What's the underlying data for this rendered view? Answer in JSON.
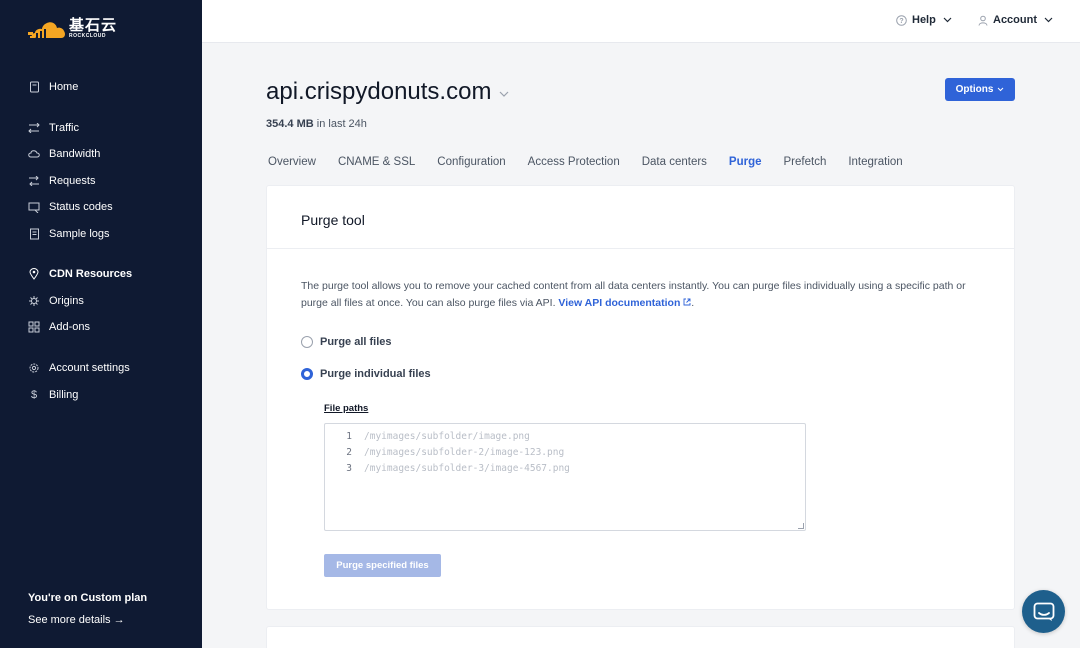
{
  "brand": {
    "name_cn": "基石云",
    "name_en": "ROCKCLOUD",
    "color": "#f5a623"
  },
  "sidebar": {
    "items": [
      {
        "label": "Home",
        "icon": "home-icon"
      },
      {
        "label": "Traffic",
        "icon": "traffic-icon"
      },
      {
        "label": "Bandwidth",
        "icon": "bandwidth-icon"
      },
      {
        "label": "Requests",
        "icon": "requests-icon"
      },
      {
        "label": "Status codes",
        "icon": "status-codes-icon"
      },
      {
        "label": "Sample logs",
        "icon": "sample-logs-icon"
      },
      {
        "label": "CDN Resources",
        "icon": "location-pin-icon"
      },
      {
        "label": "Origins",
        "icon": "origins-icon"
      },
      {
        "label": "Add-ons",
        "icon": "addons-icon"
      },
      {
        "label": "Account settings",
        "icon": "gear-icon"
      },
      {
        "label": "Billing",
        "icon": "dollar-icon"
      }
    ],
    "plan_text": "You're on Custom plan",
    "plan_link": "See more details →"
  },
  "topbar": {
    "help": "Help",
    "account": "Account"
  },
  "header": {
    "domain": "api.crispydonuts.com",
    "usage_value": "354.4 MB",
    "usage_suffix": " in last 24h",
    "options": "Options"
  },
  "tabs": [
    "Overview",
    "CNAME & SSL",
    "Configuration",
    "Access Protection",
    "Data centers",
    "Purge",
    "Prefetch",
    "Integration"
  ],
  "active_tab": "Purge",
  "purge": {
    "title": "Purge tool",
    "description": "The purge tool allows you to remove your cached content from all data centers instantly. You can purge files individually using a specific path or purge all files at once. You can also purge files via API.",
    "api_link": "View API documentation",
    "option_all": "Purge all files",
    "option_individual": "Purge individual files",
    "selected_option": "Purge individual files",
    "file_paths_label": "File paths",
    "placeholder_lines": [
      {
        "n": "1",
        "text": "/myimages/subfolder/image.png"
      },
      {
        "n": "2",
        "text": "/myimages/subfolder-2/image-123.png"
      },
      {
        "n": "3",
        "text": "/myimages/subfolder-3/image-4567.png"
      }
    ],
    "submit": "Purge specified files"
  },
  "colors": {
    "accent": "#2f63d8",
    "sidebar_bg": "#0f1a33",
    "disabled_button": "#a5b8e6",
    "chat_button": "#1e5f8c"
  }
}
